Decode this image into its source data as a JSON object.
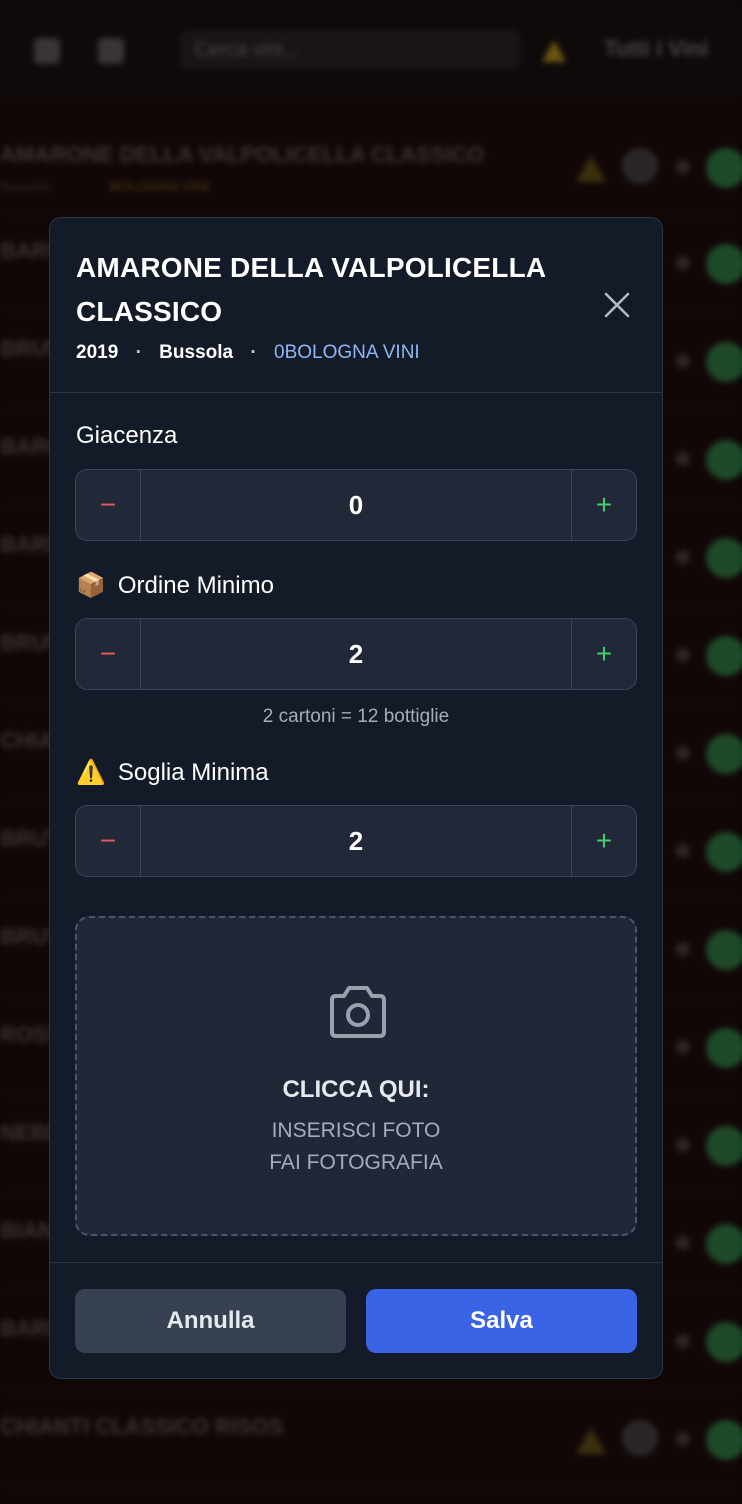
{
  "background": {
    "search_placeholder": "Cerca vini...",
    "filter_label": "Tutti i Vini",
    "rows": [
      {
        "title": "AMARONE DELLA VALPOLICELLA CLASSICO",
        "sub": "Bussola",
        "distributor": "BOLOGNA VINI"
      },
      {
        "title": "BAROLO",
        "sub": "",
        "distributor": ""
      },
      {
        "title": "BRUNELLO",
        "sub": "",
        "distributor": ""
      },
      {
        "title": "BAROLO",
        "sub": "",
        "distributor": ""
      },
      {
        "title": "BARBERA",
        "sub": "",
        "distributor": ""
      },
      {
        "title": "BRUNELLO",
        "sub": "",
        "distributor": ""
      },
      {
        "title": "CHIANTI",
        "sub": "",
        "distributor": ""
      },
      {
        "title": "BRUT",
        "sub": "",
        "distributor": ""
      },
      {
        "title": "BRUT",
        "sub": "",
        "distributor": ""
      },
      {
        "title": "ROSSO",
        "sub": "",
        "distributor": ""
      },
      {
        "title": "NEBBIOLO",
        "sub": "",
        "distributor": ""
      },
      {
        "title": "BIANCO",
        "sub": "",
        "distributor": ""
      },
      {
        "title": "BAROLO",
        "sub": "",
        "distributor": ""
      },
      {
        "title": "CHIANTI CLASSICO RISOS",
        "sub": "",
        "distributor": ""
      }
    ]
  },
  "modal": {
    "title": "AMARONE DELLA VALPOLICELLA CLASSICO",
    "year": "2019",
    "producer": "Bussola",
    "separator": "·",
    "distributor_prefix": "0",
    "distributor": "BOLOGNA VINI",
    "fields": {
      "giacenza": {
        "label": "Giacenza",
        "value": "0",
        "minus": "−",
        "plus": "+"
      },
      "ordine_minimo": {
        "icon": "📦",
        "label": "Ordine Minimo",
        "value": "2",
        "minus": "−",
        "plus": "+",
        "hint": "2 cartoni = 12 bottiglie"
      },
      "soglia_minima": {
        "icon": "⚠️",
        "label": "Soglia Minima",
        "value": "2",
        "minus": "−",
        "plus": "+"
      }
    },
    "upload": {
      "icon": "camera-icon",
      "title": "CLICCA QUI:",
      "line1": "INSERISCI FOTO",
      "line2": "FAI FOTOGRAFIA"
    },
    "buttons": {
      "cancel": "Annulla",
      "save": "Salva"
    }
  },
  "colors": {
    "modal_bg": "#131a28",
    "minus": "#e05a5a",
    "plus": "#3fd06a",
    "save": "#3b63e6",
    "distributor": "#8fb7f5"
  }
}
